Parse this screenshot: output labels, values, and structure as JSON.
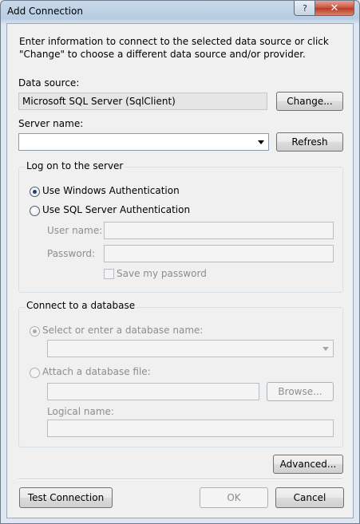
{
  "window": {
    "title": "Add Connection",
    "help_glyph": "?",
    "close_glyph": "✕"
  },
  "intro_text": "Enter information to connect to the selected data source or click \"Change\" to choose a different data source and/or provider.",
  "data_source": {
    "label": "Data source:",
    "value": "Microsoft SQL Server (SqlClient)",
    "change_button": "Change..."
  },
  "server": {
    "label": "Server name:",
    "value": "",
    "refresh_button": "Refresh"
  },
  "logon": {
    "group_title": "Log on to the server",
    "windows_auth": "Use Windows Authentication",
    "sql_auth": "Use SQL Server Authentication",
    "selected": "windows",
    "user_name_label": "User name:",
    "password_label": "Password:",
    "save_password_label": "Save my password"
  },
  "database": {
    "group_title": "Connect to a database",
    "select_option": "Select or enter a database name:",
    "attach_option": "Attach a database file:",
    "browse_button": "Browse...",
    "logical_name_label": "Logical name:"
  },
  "buttons": {
    "advanced": "Advanced...",
    "test_connection": "Test Connection",
    "ok": "OK",
    "cancel": "Cancel"
  }
}
